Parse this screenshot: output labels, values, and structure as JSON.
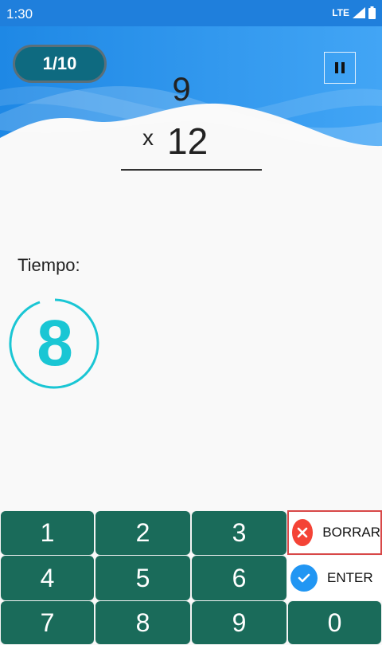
{
  "status_bar": {
    "time": "1:30",
    "network": "LTE"
  },
  "header": {
    "progress": "1/10"
  },
  "problem": {
    "top_number": "9",
    "operator": "x",
    "bottom_number": "12"
  },
  "timer": {
    "label": "Tiempo:",
    "value": "8"
  },
  "keypad": {
    "keys": [
      "1",
      "2",
      "3",
      "4",
      "5",
      "6",
      "7",
      "8",
      "9",
      "0"
    ],
    "delete_label": "BORRAR",
    "enter_label": "ENTER"
  },
  "colors": {
    "header_blue": "#2196f3",
    "keypad_green": "#1a6b5a",
    "timer_cyan": "#1ac6d4",
    "delete_red": "#f44336",
    "enter_blue": "#2196f3"
  }
}
